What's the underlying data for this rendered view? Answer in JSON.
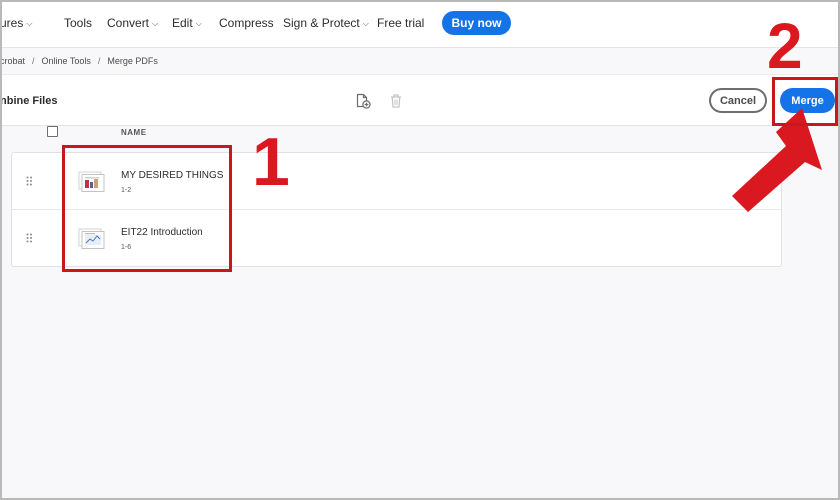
{
  "nav": {
    "items": [
      {
        "label": "ures",
        "caret": true
      },
      {
        "label": "Tools",
        "caret": false
      },
      {
        "label": "Convert",
        "caret": true
      },
      {
        "label": "Edit",
        "caret": true
      },
      {
        "label": "Compress",
        "caret": false
      },
      {
        "label": "Sign & Protect",
        "caret": true
      },
      {
        "label": "Free trial",
        "caret": false
      }
    ],
    "buy_label": "Buy now",
    "caret_glyph": "⌵"
  },
  "breadcrumb": {
    "items": [
      "crobat",
      "Online Tools",
      "Merge PDFs"
    ],
    "separator": "/"
  },
  "toolbar": {
    "title": "nbine Files",
    "add_file_icon": "add-file-icon",
    "delete_icon": "trash-icon",
    "cancel_label": "Cancel",
    "merge_label": "Merge"
  },
  "list": {
    "header_name": "NAME",
    "files": [
      {
        "name": "MY DESIRED THINGS",
        "pages": "1-2"
      },
      {
        "name": "EIT22 Introduction",
        "pages": "1-6"
      }
    ]
  },
  "annotations": {
    "step1": "1",
    "step2": "2",
    "color": "#d9191f"
  },
  "colors": {
    "accent": "#1473e6",
    "annotation": "#c8171d"
  }
}
